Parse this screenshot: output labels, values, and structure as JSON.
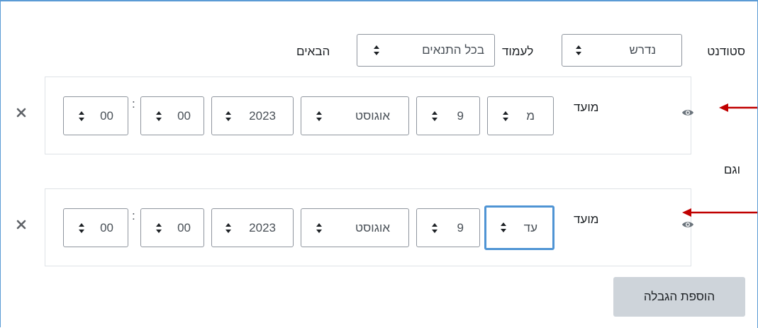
{
  "top_row": {
    "prefix_label": "סטודנט",
    "must_select": "נדרש",
    "meet_label": "לעמוד",
    "conditions_select": "בכל התנאים",
    "suffix_label": "הבאים"
  },
  "restrictions": [
    {
      "label": "מועד",
      "direction": "מ",
      "day": "9",
      "month": "אוגוסט",
      "year": "2023",
      "hour": "00",
      "minute": "00",
      "separator": ":"
    },
    {
      "label": "מועד",
      "direction": "עד",
      "day": "9",
      "month": "אוגוסט",
      "year": "2023",
      "hour": "00",
      "minute": "00",
      "separator": ":"
    }
  ],
  "and_label": "וגם",
  "add_restriction_button": "הוספת הגבלה",
  "colors": {
    "annotation_arrow": "#c00000",
    "focus_border": "#4f94d4",
    "frame_border": "#5b9bd5",
    "button_bg": "#ced4da"
  },
  "icons": {
    "eye": "eye-icon",
    "remove": "close-icon",
    "select_arrows": "sort-arrows-icon"
  }
}
